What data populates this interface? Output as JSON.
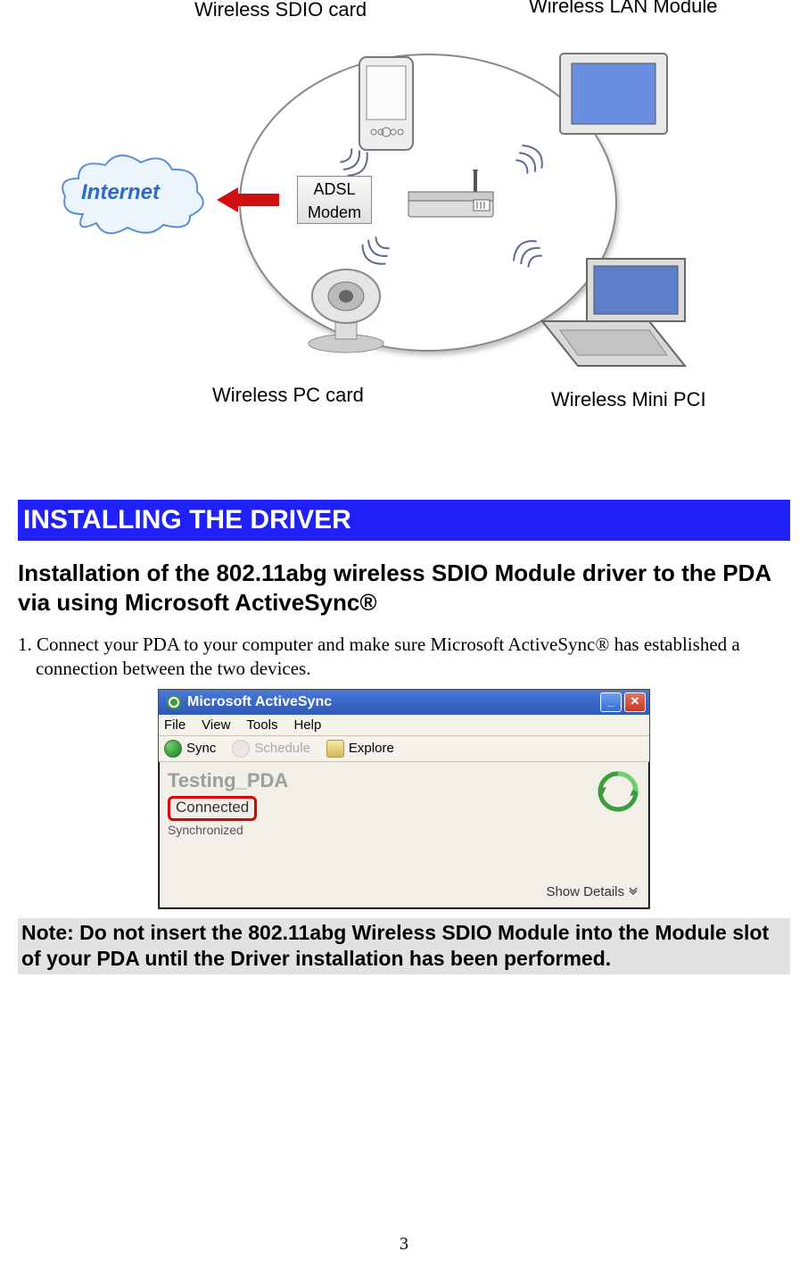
{
  "diagram": {
    "labels": {
      "sdio": "Wireless SDIO card",
      "lan": "Wireless LAN Module",
      "pcCard": "Wireless PC card",
      "miniPci": "Wireless Mini PCI",
      "internet": "Internet",
      "adsl_line1": "ADSL",
      "adsl_line2": "Modem"
    }
  },
  "section": {
    "title": "INSTALLING THE DRIVER",
    "subheading": "Installation of the 802.11abg wireless SDIO Module driver to the PDA via using Microsoft ActiveSync®",
    "step1": "1. Connect your PDA to your computer and make sure Microsoft ActiveSync® has established a connection between the two devices.",
    "note": "Note: Do not insert the 802.11abg Wireless SDIO Module into the Module slot of your PDA until the Driver installation has been performed."
  },
  "activesync": {
    "title": "Microsoft ActiveSync",
    "menu": [
      "File",
      "View",
      "Tools",
      "Help"
    ],
    "toolbar": {
      "sync": "Sync",
      "schedule": "Schedule",
      "explore": "Explore"
    },
    "device_name": "Testing_PDA",
    "status": "Connected",
    "substatus": "Synchronized",
    "show_details": "Show Details"
  },
  "page_number": "3"
}
